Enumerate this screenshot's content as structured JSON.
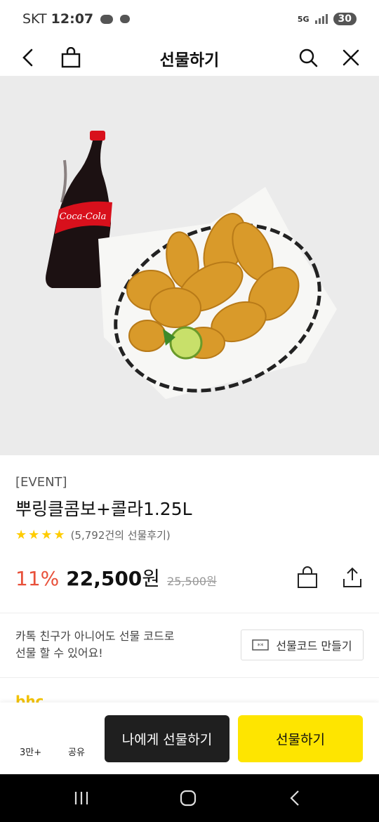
{
  "status_bar": {
    "carrier": "SKT",
    "time": "12:07",
    "talk_badge": "TALK",
    "network": "5G",
    "battery": "30"
  },
  "header": {
    "title": "선물하기",
    "icons": [
      "back-icon",
      "shopping-bag-icon",
      "search-icon",
      "close-icon"
    ]
  },
  "product": {
    "event_tag": "[EVENT]",
    "name": "뿌링클콤보+콜라1.25L",
    "rating_stars": 4,
    "review_text": "(5,792건의 선물후기)",
    "discount": "11%",
    "price": "22,500",
    "price_unit": "원",
    "original_price": "25,500원"
  },
  "promo": {
    "line1": "카톡 친구가 아니어도 선물 코드로",
    "line2": "선물 할 수 있어요!",
    "code_button": "선물코드 만들기"
  },
  "peek_brand": "bhc",
  "bottom_bar": {
    "wish_count": "3만+",
    "share_label": "공유",
    "self_gift_label": "나에게 선물하기",
    "gift_label": "선물하기"
  },
  "colors": {
    "accent_yellow": "#fee500",
    "discount_red": "#e8503a",
    "star_yellow": "#ffcc00",
    "dark_button": "#1f1f1f"
  }
}
